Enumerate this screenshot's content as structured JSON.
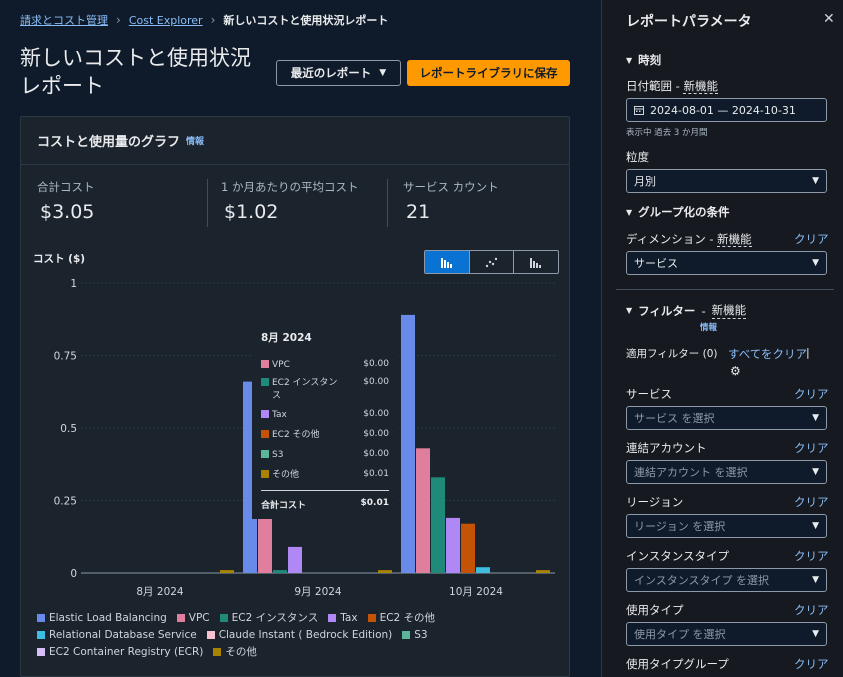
{
  "breadcrumb": {
    "home": "請求とコスト管理",
    "explorer": "Cost Explorer",
    "current": "新しいコストと使用状況レポート"
  },
  "header": {
    "title_line1": "新しいコストと使用状況",
    "title_line2": "レポート",
    "recent_btn": "最近のレポート",
    "save_btn": "レポートライブラリに保存"
  },
  "panel": {
    "title": "コストと使用量のグラフ",
    "info": "情報",
    "metrics": [
      {
        "label": "合計コスト",
        "value": "$3.05"
      },
      {
        "label": "1 か月あたりの平均コスト",
        "value": "$1.02"
      },
      {
        "label": "サービス カウント",
        "value": "21"
      }
    ],
    "y_label": "コスト ($)"
  },
  "chart_data": {
    "type": "bar",
    "categories": [
      "8月 2024",
      "9月 2024",
      "10月 2024"
    ],
    "ylabel": "コスト ($)",
    "ylim": [
      0,
      1
    ],
    "yticks": [
      "0",
      "0.25",
      "0.5",
      "0.75",
      "1"
    ],
    "series": [
      {
        "name": "Elastic Load Balancing",
        "color": "#688ae8",
        "values": [
          0,
          0.66,
          0.89
        ]
      },
      {
        "name": "VPC",
        "color": "#e07f9d",
        "values": [
          0,
          0.4,
          0.43
        ]
      },
      {
        "name": "EC2 インスタンス",
        "color": "#1f8a7a",
        "values": [
          0,
          0.01,
          0.33
        ]
      },
      {
        "name": "Tax",
        "color": "#b088f5",
        "values": [
          0,
          0.09,
          0.19
        ]
      },
      {
        "name": "EC2 その他",
        "color": "#c55305",
        "values": [
          0,
          0,
          0.17
        ]
      },
      {
        "name": "Relational Database Service",
        "color": "#3ebde2",
        "values": [
          0,
          0,
          0.02
        ]
      },
      {
        "name": "Claude Instant ( Bedrock Edition)",
        "color": "#f7c1d0",
        "values": [
          0,
          0,
          0
        ]
      },
      {
        "name": "S3",
        "color": "#5cb59a",
        "values": [
          0,
          0,
          0
        ]
      },
      {
        "name": "EC2 Container Registry (ECR)",
        "color": "#d6bff9",
        "values": [
          0,
          0,
          0
        ]
      },
      {
        "name": "その他",
        "color": "#a88300",
        "values": [
          0.01,
          0.01,
          0.01
        ]
      }
    ]
  },
  "tooltip": {
    "title": "8月 2024",
    "rows": [
      {
        "name": "VPC",
        "value": "$0.00",
        "color": "#e07f9d"
      },
      {
        "name": "EC2 インスタンス",
        "value": "$0.00",
        "color": "#1f8a7a"
      },
      {
        "name": "Tax",
        "value": "$0.00",
        "color": "#b088f5"
      },
      {
        "name": "EC2 その他",
        "value": "$0.00",
        "color": "#c55305"
      },
      {
        "name": "S3",
        "value": "$0.00",
        "color": "#5cb59a"
      },
      {
        "name": "その他",
        "value": "$0.01",
        "color": "#a88300"
      }
    ],
    "total_label": "合計コスト",
    "total_value": "$0.01"
  },
  "sidebar": {
    "title": "レポートパラメータ",
    "time_section": "時刻",
    "date_label": "日付範囲",
    "new_tag": "新機能",
    "date_value": "2024-08-01 — 2024-10-31",
    "date_hint": "表示中 過去 3 か月間",
    "granularity_label": "粒度",
    "granularity_value": "月別",
    "group_section": "グループ化の条件",
    "dimension_label": "ディメンション",
    "clear": "クリア",
    "dimension_value": "サービス",
    "filter_section": "フィルター",
    "info": "情報",
    "applied_filters": "適用フィルター (0)",
    "clear_all": "すべてをクリア",
    "service_label": "サービス",
    "service_ph": "サービス を選択",
    "account_label": "連結アカウント",
    "account_ph": "連結アカウント を選択",
    "region_label": "リージョン",
    "region_ph": "リージョン を選択",
    "instance_label": "インスタンスタイプ",
    "instance_ph": "インスタンスタイプ を選択",
    "usage_label": "使用タイプ",
    "usage_ph": "使用タイプ を選択",
    "usage_group_label": "使用タイプグループ"
  }
}
